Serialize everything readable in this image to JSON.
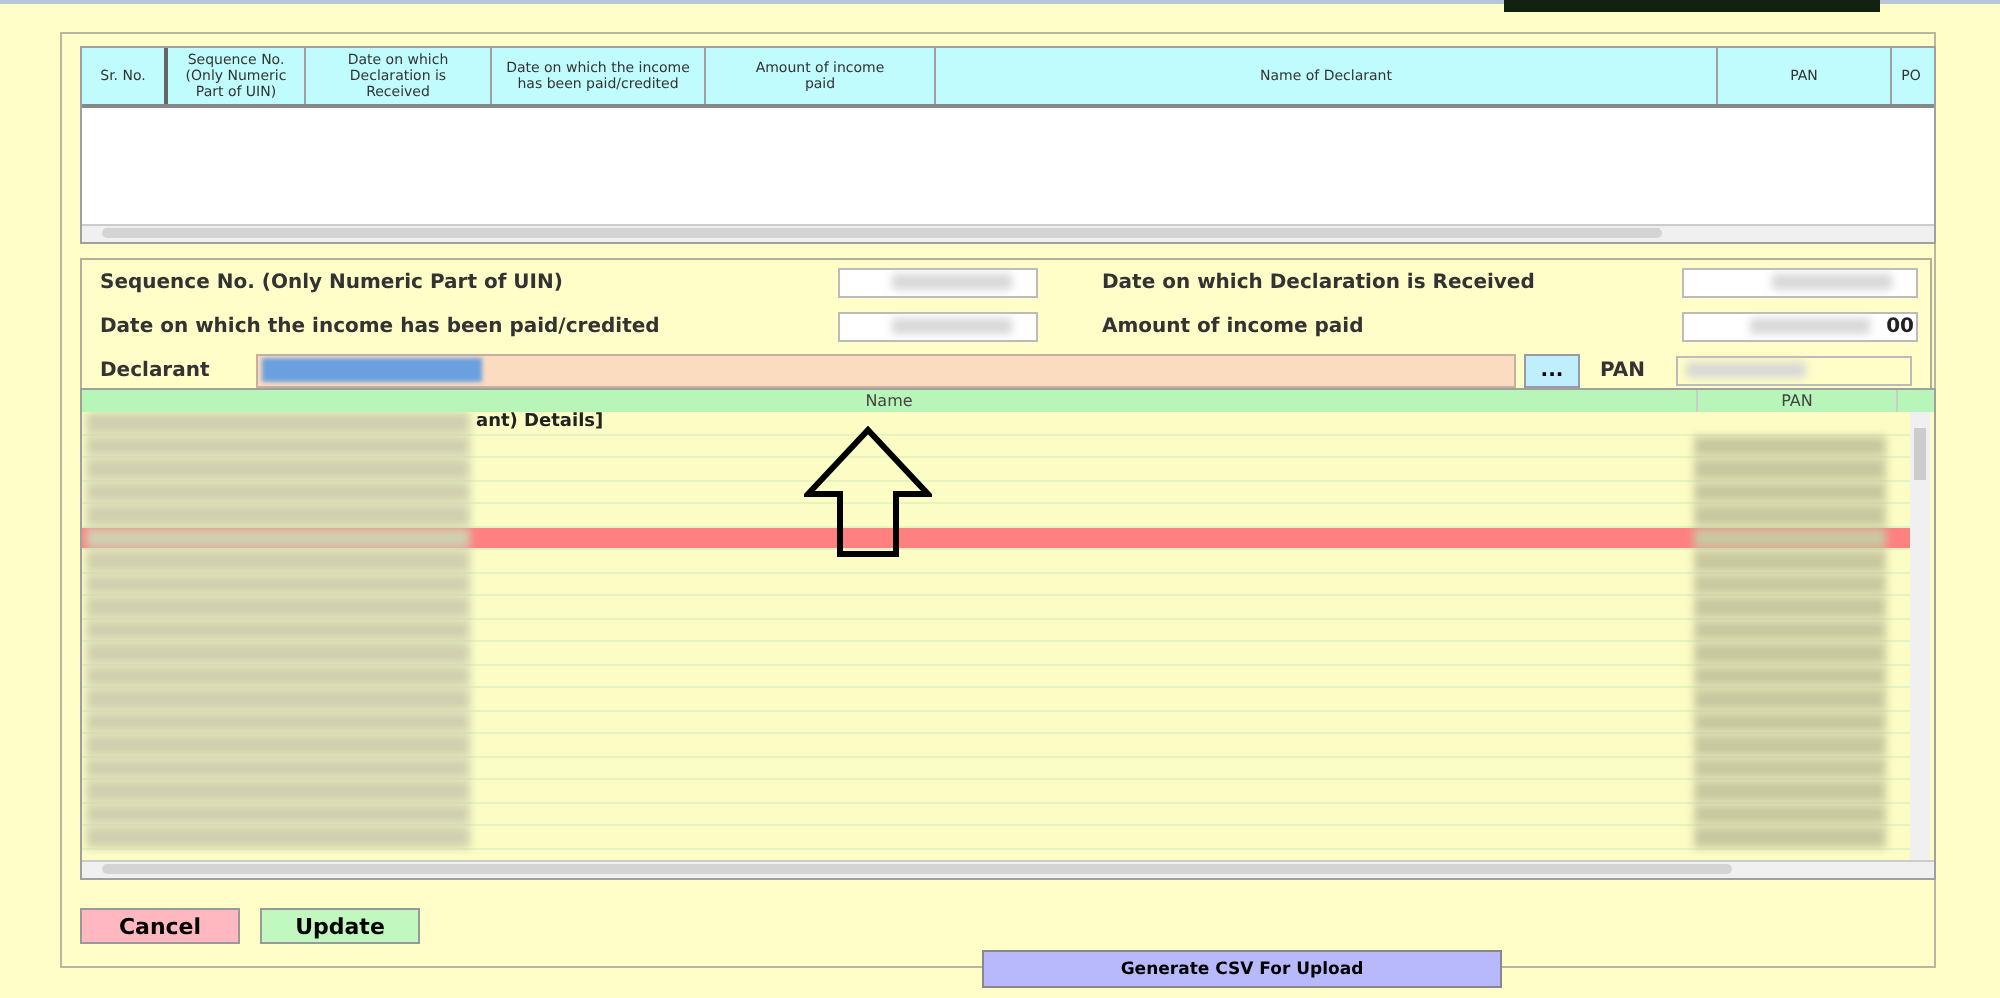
{
  "top_table": {
    "columns": [
      "Sr. No.",
      "Sequence No. (Only Numeric Part of UIN)",
      "Date on which Declaration is Received",
      "Date on which the income has been paid/credited",
      "Amount of income paid",
      "Name of Declarant",
      "PAN",
      "PO"
    ]
  },
  "form": {
    "rows": [
      [
        {
          "label": "Sequence No. (Only Numeric Part of UIN)"
        },
        {
          "label": "Date on which Declaration is Received"
        }
      ],
      [
        {
          "label": "Date on which the income has been paid/credited"
        },
        {
          "label": "Amount of income paid",
          "value": "00"
        }
      ]
    ],
    "declarant": {
      "label": "Declarant",
      "browse_button": "...",
      "pan_label": "PAN"
    }
  },
  "lookup_grid": {
    "columns": [
      "Name",
      "PAN"
    ],
    "first_row_text": "ant) Details]",
    "rows": [
      {
        "selected": false
      },
      {
        "selected": false
      },
      {
        "selected": false
      },
      {
        "selected": false
      },
      {
        "selected": false
      },
      {
        "selected": true
      },
      {
        "selected": false
      },
      {
        "selected": false
      },
      {
        "selected": false
      },
      {
        "selected": false
      },
      {
        "selected": false
      },
      {
        "selected": false
      },
      {
        "selected": false
      },
      {
        "selected": false
      },
      {
        "selected": false
      },
      {
        "selected": false
      },
      {
        "selected": false
      },
      {
        "selected": false
      },
      {
        "selected": false
      }
    ]
  },
  "buttons": [
    {
      "label": "Cancel",
      "kind": "cancel"
    },
    {
      "label": "Update",
      "kind": "update"
    }
  ],
  "generate_button": {
    "label": "Generate CSV For Upload"
  }
}
